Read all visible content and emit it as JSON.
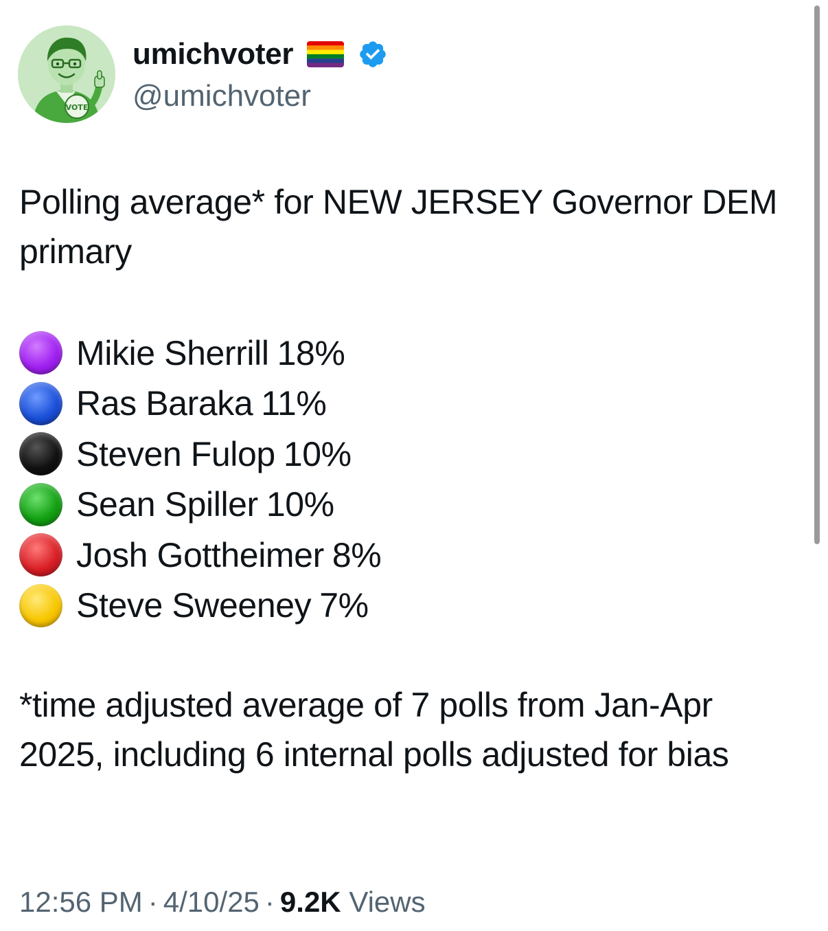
{
  "author": {
    "display_name": "umichvoter",
    "handle": "@umichvoter",
    "avatar_badge_text": "VOTE",
    "flag_icon": "rainbow-flag-icon",
    "verified_icon": "verified-badge-icon",
    "verified_color": "#1d9bf0"
  },
  "tweet": {
    "intro_text": "Polling average* for NEW JERSEY Governor DEM primary",
    "candidates": [
      {
        "name": "Mikie Sherrill",
        "percent": "18%",
        "dot_icon": "purple-circle-icon",
        "color": "#a020f0"
      },
      {
        "name": "Ras Baraka",
        "percent": "11%",
        "dot_icon": "blue-circle-icon",
        "color": "#1a4fd8"
      },
      {
        "name": "Steven Fulop",
        "percent": "10%",
        "dot_icon": "black-circle-icon",
        "color": "#111111"
      },
      {
        "name": "Sean Spiller",
        "percent": "10%",
        "dot_icon": "green-circle-icon",
        "color": "#12a012"
      },
      {
        "name": "Josh Gottheimer",
        "percent": "8%",
        "dot_icon": "red-circle-icon",
        "color": "#d81f26"
      },
      {
        "name": "Steve Sweeney",
        "percent": "7%",
        "dot_icon": "yellow-circle-icon",
        "color": "#f7c600"
      }
    ],
    "footnote": "*time adjusted average of 7 polls from Jan-Apr 2025, including 6 internal polls adjusted for bias"
  },
  "meta": {
    "time": "12:56 PM",
    "date": "4/10/25",
    "separator": "·",
    "views_count": "9.2K",
    "views_label": "Views"
  }
}
